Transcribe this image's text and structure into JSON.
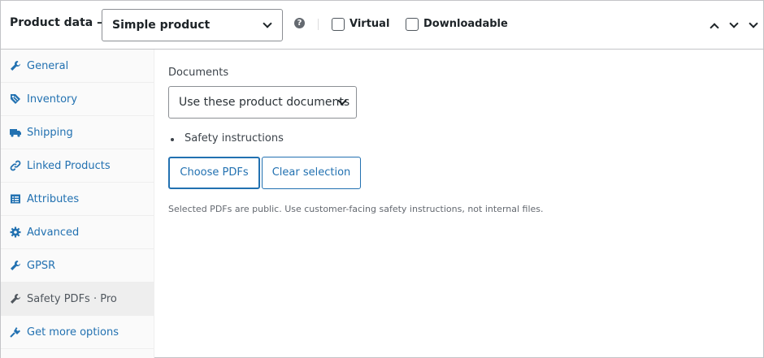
{
  "header": {
    "title": "Product data —",
    "product_type": "Simple product",
    "help_glyph": "?",
    "virtual_label": "Virtual",
    "downloadable_label": "Downloadable"
  },
  "tabs": [
    {
      "label": "General",
      "icon": "wrench-icon"
    },
    {
      "label": "Inventory",
      "icon": "tag-icon"
    },
    {
      "label": "Shipping",
      "icon": "truck-icon"
    },
    {
      "label": "Linked Products",
      "icon": "link-icon"
    },
    {
      "label": "Attributes",
      "icon": "list-icon"
    },
    {
      "label": "Advanced",
      "icon": "gear-icon"
    },
    {
      "label": "GPSR",
      "icon": "wrench-icon"
    },
    {
      "label": "Safety PDFs · Pro",
      "icon": "wrench-icon",
      "active": true
    },
    {
      "label": "Get more options",
      "icon": "plug-icon"
    }
  ],
  "main": {
    "documents_label": "Documents",
    "documents_select": "Use these product documents",
    "selected_items": [
      "Safety instructions"
    ],
    "choose_button": "Choose PDFs",
    "clear_button": "Clear selection",
    "help_text": "Selected PDFs are public. Use customer-facing safety instructions, not internal files."
  },
  "colors": {
    "link": "#2271b1",
    "text": "#1d2327",
    "muted": "#646970",
    "border": "#c3c4c7"
  }
}
